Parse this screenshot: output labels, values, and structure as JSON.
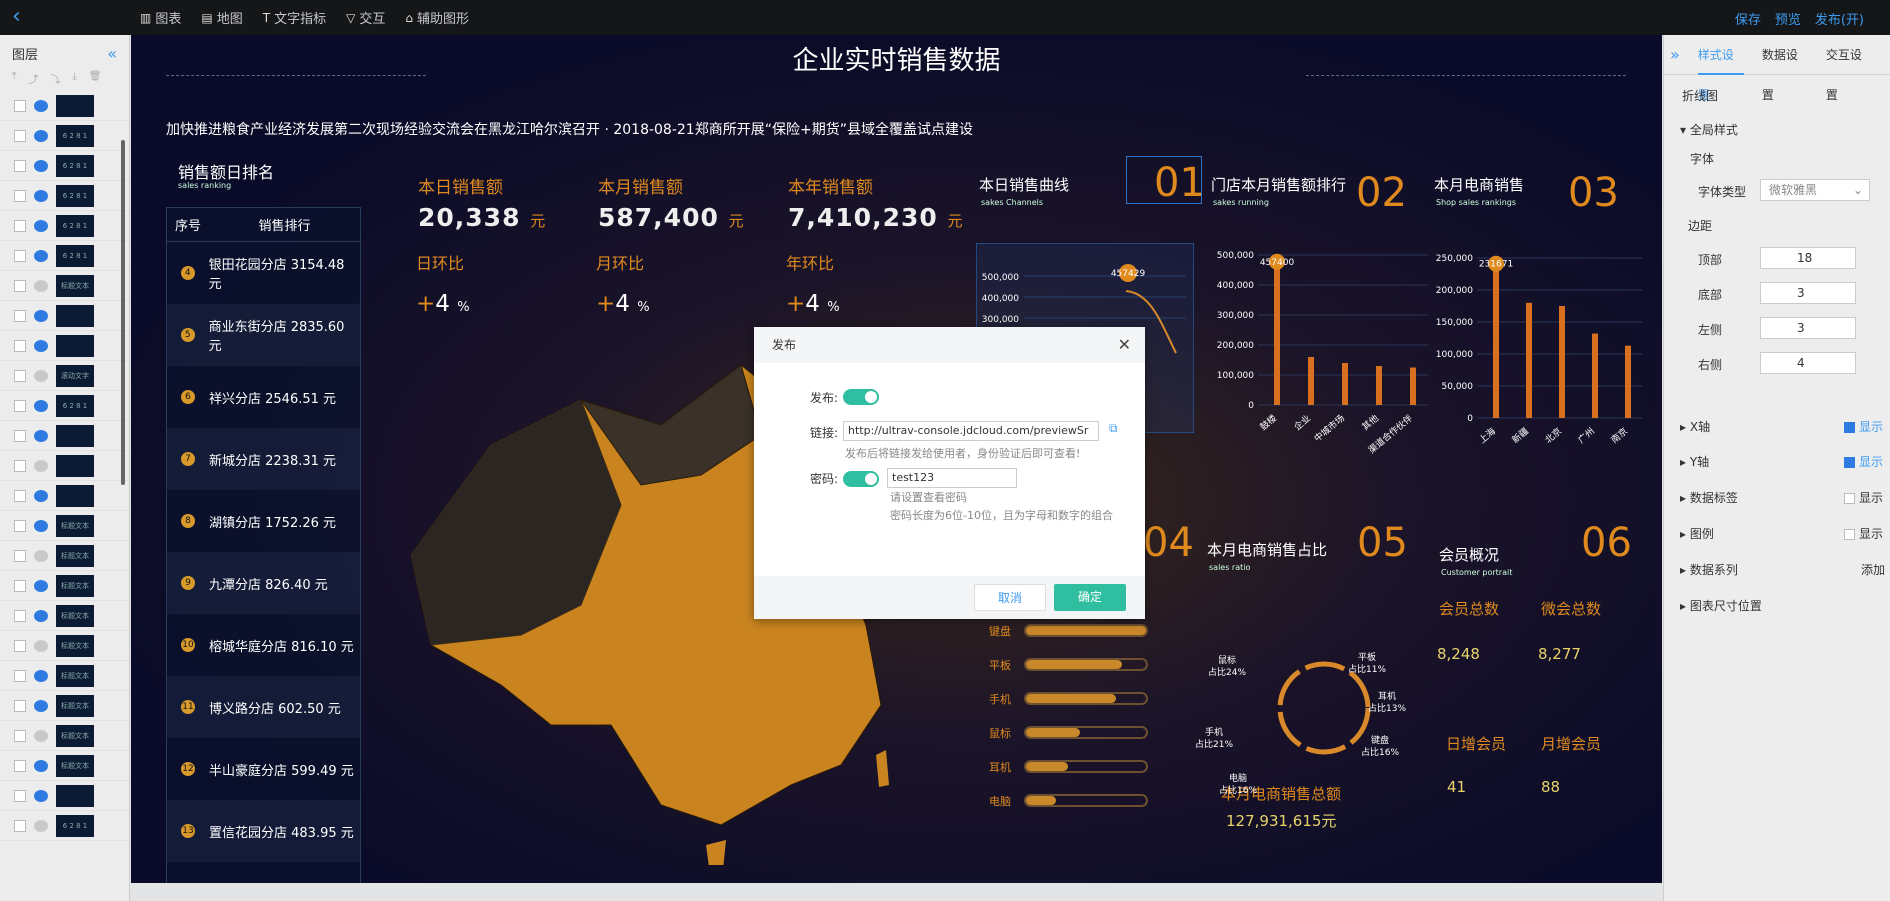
{
  "topbar": {
    "tools": [
      {
        "icon": "chart-icon",
        "label": "图表"
      },
      {
        "icon": "map-icon",
        "label": "地图"
      },
      {
        "icon": "text-icon",
        "label": "文字指标"
      },
      {
        "icon": "interaction-icon",
        "label": "交互"
      },
      {
        "icon": "shape-icon",
        "label": "辅助图形"
      }
    ],
    "save": "保存",
    "preview": "预览",
    "publish": "发布(开)"
  },
  "layers": {
    "title": "图层",
    "items": [
      "",
      "6 2 8 1",
      "6 2 8 1",
      "6 2 8 1",
      "6 2 8 1",
      "6 2 8 1",
      "标题文本",
      "",
      "",
      "滚动文字",
      "6 2 8 1",
      "",
      "",
      "",
      "标题文本",
      "标题文本",
      "标题文本",
      "标题文本",
      "标题文本",
      "标题文本",
      "标题文本",
      "标题文本",
      "标题文本",
      "",
      "6 2 8 1"
    ]
  },
  "dashboard": {
    "title": "企业实时销售数据",
    "ticker": "加快推进粮食产业经济发展第二次现场经验交流会在黑龙江哈尔滨召开 · 2018-08-21郑商所开展“保险+期货”县域全覆盖试点建设",
    "rank": {
      "title": "销售额日排名",
      "subtitle": "sales ranking",
      "col_no": "序号",
      "col_name": "销售排行",
      "rows": [
        {
          "no": "4",
          "text": "银田花园分店 3154.48 元"
        },
        {
          "no": "5",
          "text": "商业东街分店 2835.60 元"
        },
        {
          "no": "6",
          "text": "祥兴分店 2546.51 元"
        },
        {
          "no": "7",
          "text": "新城分店 2238.31 元"
        },
        {
          "no": "8",
          "text": "湖镇分店 1752.26 元"
        },
        {
          "no": "9",
          "text": "九潭分店 826.40 元"
        },
        {
          "no": "10",
          "text": "榕城华庭分店 816.10 元"
        },
        {
          "no": "11",
          "text": "博义路分店 602.50 元"
        },
        {
          "no": "12",
          "text": "半山豪庭分店 599.49 元"
        },
        {
          "no": "13",
          "text": "置信花园分店 483.95 元"
        }
      ]
    },
    "kpis": [
      {
        "label": "本日销售额",
        "value": "20,338",
        "unit": "元",
        "cmp_label": "日环比",
        "cmp": "+4",
        "cmp_unit": "%"
      },
      {
        "label": "本月销售额",
        "value": "587,400",
        "unit": "元",
        "cmp_label": "月环比",
        "cmp": "+4",
        "cmp_unit": "%"
      },
      {
        "label": "本年销售额",
        "value": "7,410,230",
        "unit": "元",
        "cmp_label": "年环比",
        "cmp": "+4",
        "cmp_unit": "%"
      }
    ],
    "panels": [
      {
        "no": "01",
        "title": "本日销售曲线",
        "subtitle": "sakes Channels"
      },
      {
        "no": "02",
        "title": "门店本月销售额排行",
        "subtitle": "sakes running"
      },
      {
        "no": "03",
        "title": "本月电商销售",
        "subtitle": "Shop sales rankings"
      },
      {
        "no": "04",
        "title": "",
        "subtitle": ""
      },
      {
        "no": "05",
        "title": "本月电商销售占比",
        "subtitle": "sales ratio"
      },
      {
        "no": "06",
        "title": "会员概况",
        "subtitle": "Customer portrait"
      }
    ],
    "members": {
      "total_label": "会员总数",
      "total": "8,248",
      "wechat_label": "微会总数",
      "wechat": "8,277",
      "daily_label": "日增会员",
      "daily": "41",
      "monthly_label": "月增会员",
      "monthly": "88"
    },
    "ecom_total_label": "本月电商销售总额",
    "ecom_total": "127,931,615元",
    "ratio_labels": [
      {
        "name": "鼠标",
        "pct": "占比24%"
      },
      {
        "name": "平板",
        "pct": "占比11%"
      },
      {
        "name": "耳机",
        "pct": "占比13%"
      },
      {
        "name": "键盘",
        "pct": "占比16%"
      },
      {
        "name": "电脑",
        "pct": "占比16%"
      },
      {
        "name": "手机",
        "pct": "占比21%"
      }
    ],
    "bar_items": [
      "键盘",
      "平板",
      "手机",
      "鼠标",
      "耳机",
      "电脑"
    ]
  },
  "chart_data": [
    {
      "type": "line",
      "title": "本日销售曲线",
      "yticks": [
        "500,000",
        "400,000",
        "300,000"
      ],
      "peak_label": "457429",
      "ylim": [
        250000,
        550000
      ]
    },
    {
      "type": "bar",
      "title": "门店本月销售额排行",
      "categories": [
        "鼓楼",
        "企业",
        "中城市场",
        "其他",
        "渠道合作伙伴"
      ],
      "values": [
        457400,
        160000,
        140000,
        130000,
        125000
      ],
      "peak_label": "457400",
      "yticks": [
        "0",
        "100,000",
        "200,000",
        "300,000",
        "400,000",
        "500,000"
      ],
      "ylim": [
        0,
        500000
      ]
    },
    {
      "type": "bar",
      "title": "本月电商销售",
      "categories": [
        "上海",
        "新疆",
        "北京",
        "广州",
        "南京"
      ],
      "values": [
        231671,
        180000,
        175000,
        132000,
        113000
      ],
      "peak_label": "231671",
      "yticks": [
        "0",
        "50,000",
        "100,000",
        "150,000",
        "200,000",
        "250,000"
      ],
      "ylim": [
        0,
        250000
      ]
    }
  ],
  "right_panel": {
    "tabs": [
      "样式设置",
      "数据设置",
      "交互设置"
    ],
    "chart_type": "折线图",
    "global_style": "全局样式",
    "font_label": "字体",
    "font_type_label": "字体类型",
    "font_type_value": "微软雅黑",
    "margin_label": "边距",
    "top_label": "顶部",
    "top_value": "18",
    "bottom_label": "底部",
    "bottom_value": "3",
    "left_label": "左侧",
    "left_value": "3",
    "right_label": "右侧",
    "right_value": "4",
    "x_axis": "X轴",
    "y_axis": "Y轴",
    "data_label": "数据标签",
    "legend": "图例",
    "show": "显示",
    "series": "数据系列",
    "add": "添加",
    "size_pos": "图表尺寸位置"
  },
  "modal": {
    "title": "发布",
    "publish_label": "发布:",
    "link_label": "链接:",
    "link_value": "http://ultrav-console.jdcloud.com/previewSr",
    "link_hint": "发布后将链接发给使用者，身份验证后即可查看!",
    "pwd_label": "密码:",
    "pwd_value": "test123",
    "pwd_hint1": "请设置查看密码",
    "pwd_hint2": "密码长度为6位-10位，且为字母和数字的组合",
    "cancel": "取消",
    "ok": "确定"
  },
  "colors": {
    "accent": "#3d9bf0",
    "orange": "#e08a1e",
    "teal": "#2fbfa0"
  }
}
